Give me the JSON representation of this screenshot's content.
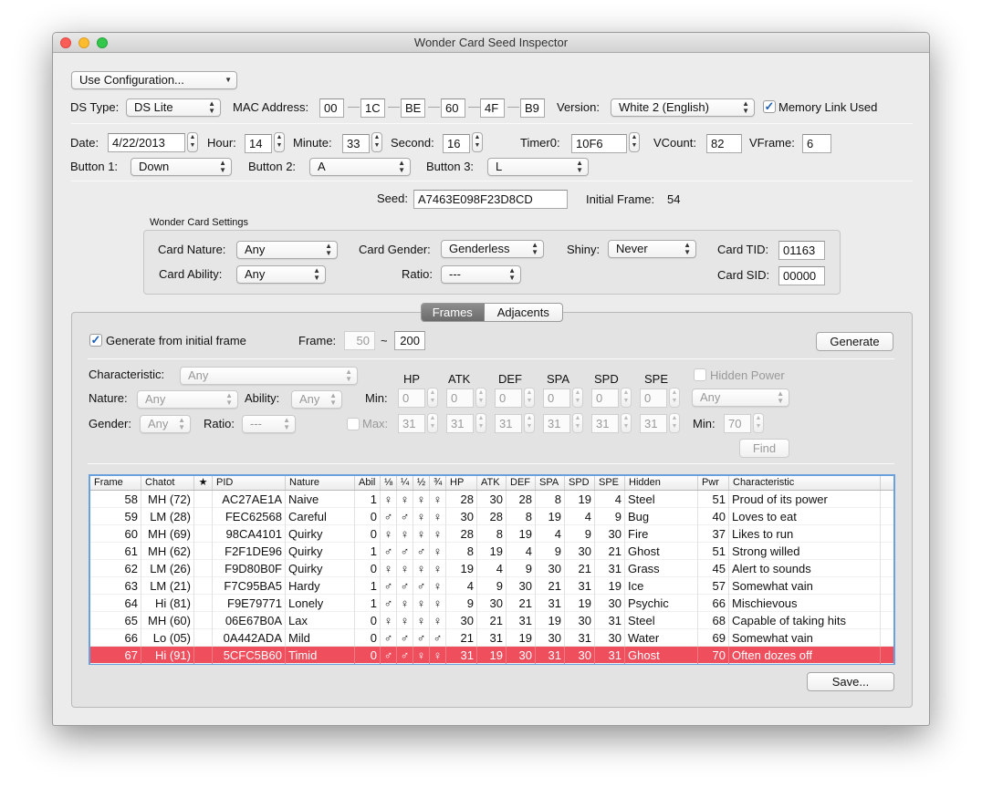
{
  "window": {
    "title": "Wonder Card Seed Inspector"
  },
  "config_popup": "Use Configuration...",
  "ds": {
    "type_label": "DS Type:",
    "type_value": "DS Lite",
    "mac_label": "MAC Address:",
    "mac": [
      "00",
      "1C",
      "BE",
      "60",
      "4F",
      "B9"
    ],
    "version_label": "Version:",
    "version_value": "White 2 (English)",
    "memory_link_label": "Memory Link Used",
    "memory_link_checked": true
  },
  "time": {
    "date_label": "Date:",
    "date": "4/22/2013",
    "hour_label": "Hour:",
    "hour": "14",
    "minute_label": "Minute:",
    "minute": "33",
    "second_label": "Second:",
    "second": "16",
    "timer0_label": "Timer0:",
    "timer0": "10F6",
    "vcount_label": "VCount:",
    "vcount": "82",
    "vframe_label": "VFrame:",
    "vframe": "6"
  },
  "buttons": {
    "b1_label": "Button 1:",
    "b1": "Down",
    "b2_label": "Button 2:",
    "b2": "A",
    "b3_label": "Button 3:",
    "b3": "L"
  },
  "seed": {
    "label": "Seed:",
    "value": "A7463E098F23D8CD",
    "initial_frame_label": "Initial Frame:",
    "initial_frame": "54"
  },
  "wonder_card": {
    "group_title": "Wonder Card Settings",
    "nature_label": "Card Nature:",
    "nature": "Any",
    "gender_label": "Card Gender:",
    "gender": "Genderless",
    "shiny_label": "Shiny:",
    "shiny": "Never",
    "tid_label": "Card TID:",
    "tid": "01163",
    "ability_label": "Card Ability:",
    "ability": "Any",
    "ratio_label": "Ratio:",
    "ratio": "---",
    "sid_label": "Card SID:",
    "sid": "00000"
  },
  "tabs": [
    "Frames",
    "Adjacents"
  ],
  "frames": {
    "gen_initial_label": "Generate from initial frame",
    "gen_initial_checked": true,
    "frame_label": "Frame:",
    "frame_from": "50",
    "tilde": "~",
    "frame_to": "200",
    "generate": "Generate"
  },
  "filters": {
    "characteristic_label": "Characteristic:",
    "characteristic": "Any",
    "nature_label": "Nature:",
    "nature": "Any",
    "ability_label": "Ability:",
    "ability": "Any",
    "gender_label": "Gender:",
    "gender": "Any",
    "ratio_label": "Ratio:",
    "ratio": "---",
    "stat_headers": [
      "HP",
      "ATK",
      "DEF",
      "SPA",
      "SPD",
      "SPE"
    ],
    "min_label": "Min:",
    "min": [
      "0",
      "0",
      "0",
      "0",
      "0",
      "0"
    ],
    "max_label": "Max:",
    "max": [
      "31",
      "31",
      "31",
      "31",
      "31",
      "31"
    ],
    "hidden_power_label": "Hidden Power",
    "hidden_power_type": "Any",
    "hp_min_label": "Min:",
    "hp_min": "70",
    "find": "Find"
  },
  "table": {
    "headers": [
      "Frame",
      "Chatot",
      "★",
      "PID",
      "Nature",
      "Abil",
      "⅛",
      "¼",
      "½",
      "¾",
      "HP",
      "ATK",
      "DEF",
      "SPA",
      "SPD",
      "SPE",
      "Hidden",
      "Pwr",
      "Characteristic"
    ],
    "rows": [
      [
        "58",
        "MH (72)",
        "",
        "AC27AE1A",
        "Naive",
        "1",
        "♀",
        "♀",
        "♀",
        "♀",
        "28",
        "30",
        "28",
        "8",
        "19",
        "4",
        "Steel",
        "51",
        "Proud of its power"
      ],
      [
        "59",
        "LM (28)",
        "",
        "FEC62568",
        "Careful",
        "0",
        "♂",
        "♂",
        "♀",
        "♀",
        "30",
        "28",
        "8",
        "19",
        "4",
        "9",
        "Bug",
        "40",
        "Loves to eat"
      ],
      [
        "60",
        "MH (69)",
        "",
        "98CA4101",
        "Quirky",
        "0",
        "♀",
        "♀",
        "♀",
        "♀",
        "28",
        "8",
        "19",
        "4",
        "9",
        "30",
        "Fire",
        "37",
        "Likes to run"
      ],
      [
        "61",
        "MH (62)",
        "",
        "F2F1DE96",
        "Quirky",
        "1",
        "♂",
        "♂",
        "♂",
        "♀",
        "8",
        "19",
        "4",
        "9",
        "30",
        "21",
        "Ghost",
        "51",
        "Strong willed"
      ],
      [
        "62",
        "LM (26)",
        "",
        "F9D80B0F",
        "Quirky",
        "0",
        "♀",
        "♀",
        "♀",
        "♀",
        "19",
        "4",
        "9",
        "30",
        "21",
        "31",
        "Grass",
        "45",
        "Alert to sounds"
      ],
      [
        "63",
        "LM (21)",
        "",
        "F7C95BA5",
        "Hardy",
        "1",
        "♂",
        "♂",
        "♂",
        "♀",
        "4",
        "9",
        "30",
        "21",
        "31",
        "19",
        "Ice",
        "57",
        "Somewhat vain"
      ],
      [
        "64",
        "Hi (81)",
        "",
        "F9E79771",
        "Lonely",
        "1",
        "♂",
        "♀",
        "♀",
        "♀",
        "9",
        "30",
        "21",
        "31",
        "19",
        "30",
        "Psychic",
        "66",
        "Mischievous"
      ],
      [
        "65",
        "MH (60)",
        "",
        "06E67B0A",
        "Lax",
        "0",
        "♀",
        "♀",
        "♀",
        "♀",
        "30",
        "21",
        "31",
        "19",
        "30",
        "31",
        "Steel",
        "68",
        "Capable of taking hits"
      ],
      [
        "66",
        "Lo (05)",
        "",
        "0A442ADA",
        "Mild",
        "0",
        "♂",
        "♂",
        "♂",
        "♂",
        "21",
        "31",
        "19",
        "30",
        "31",
        "30",
        "Water",
        "69",
        "Somewhat vain"
      ],
      [
        "67",
        "Hi (91)",
        "",
        "5CFC5B60",
        "Timid",
        "0",
        "♂",
        "♂",
        "♀",
        "♀",
        "31",
        "19",
        "30",
        "31",
        "30",
        "31",
        "Ghost",
        "70",
        "Often dozes off"
      ]
    ],
    "selected_row": 9
  },
  "save": "Save...",
  "colors": {
    "selection": "#ef4e5d",
    "table_focus": "#6aa0dc"
  }
}
